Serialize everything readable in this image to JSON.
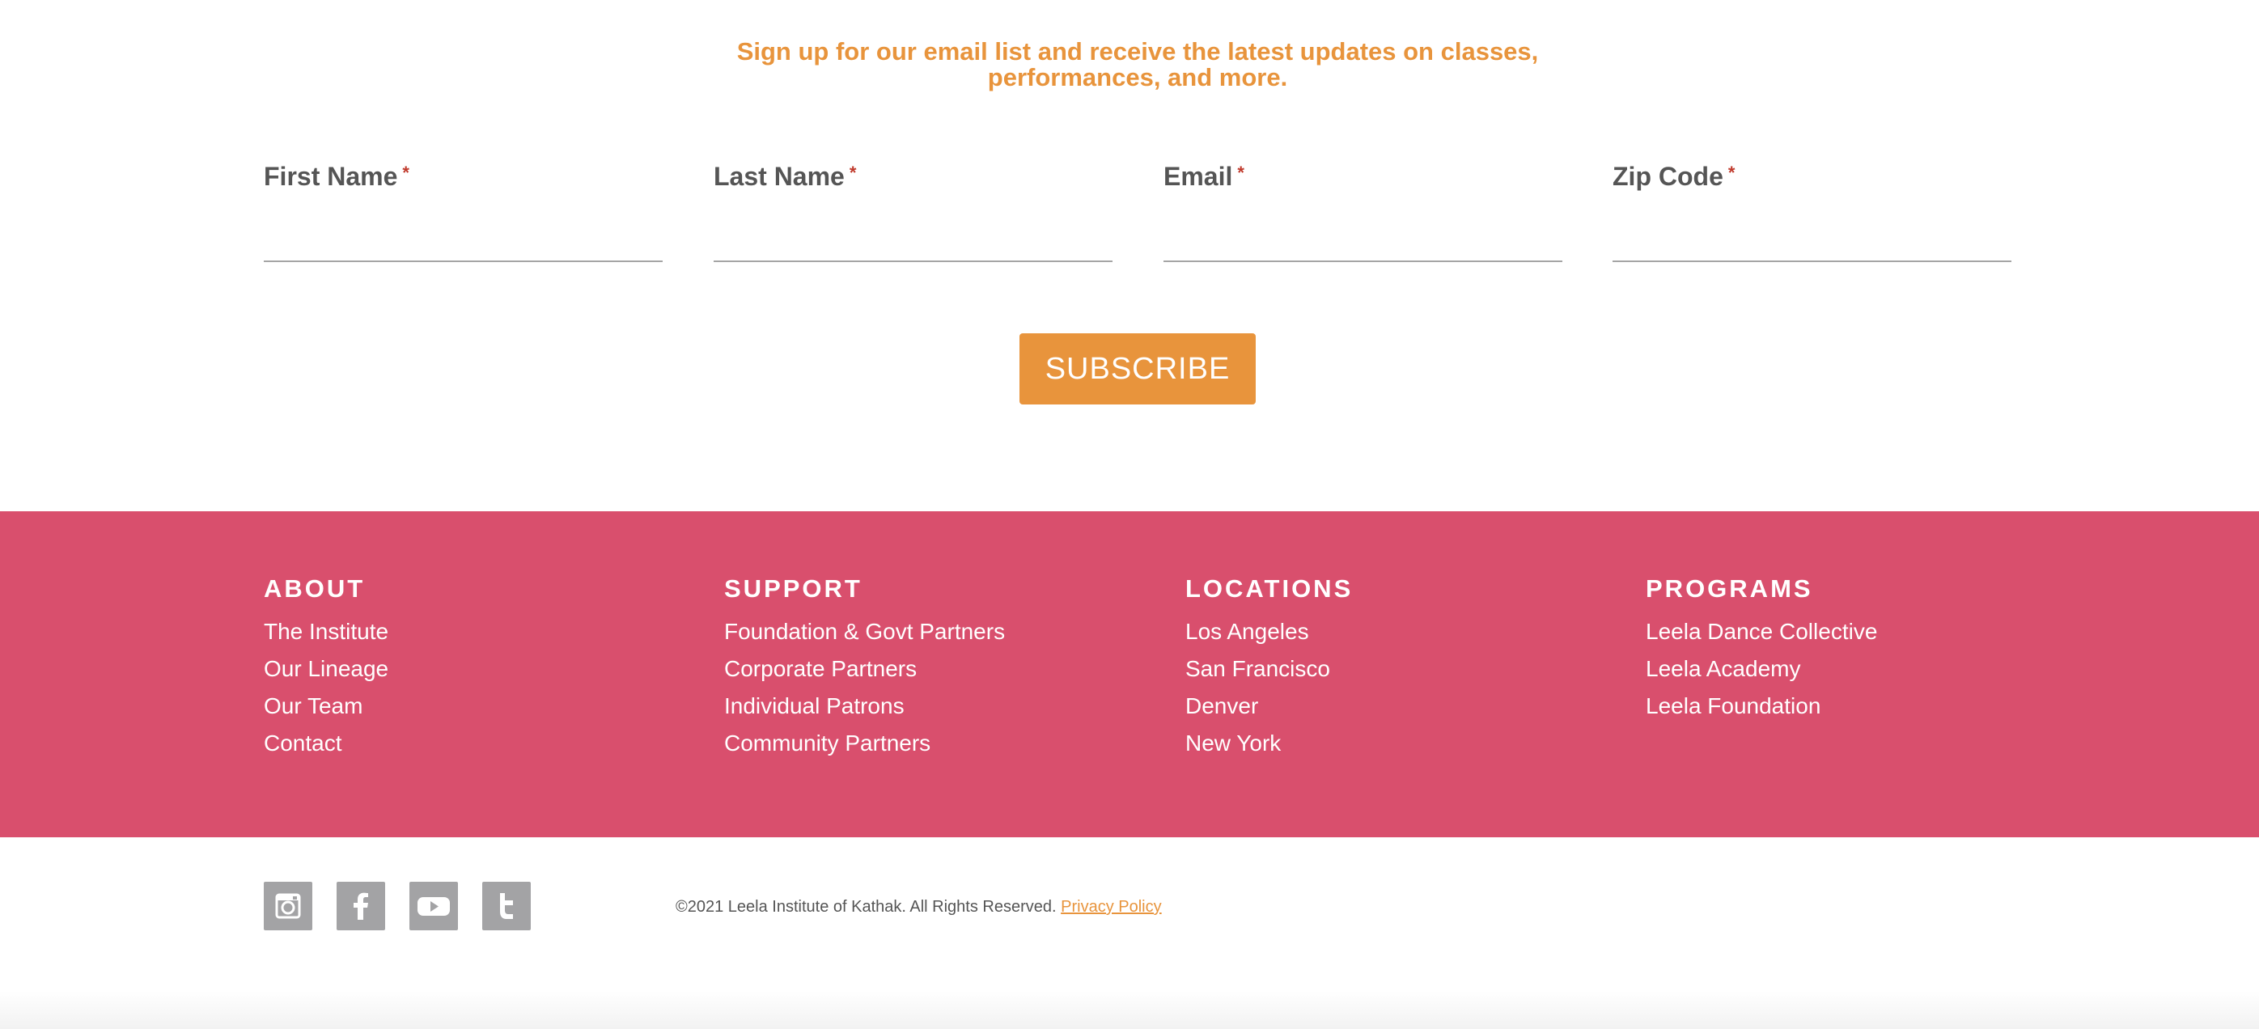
{
  "signup": {
    "heading": "Sign up for our email list and receive the latest updates on classes, performances, and more.",
    "required_marker": "*",
    "fields": [
      {
        "label": "First Name",
        "value": ""
      },
      {
        "label": "Last Name",
        "value": ""
      },
      {
        "label": "Email",
        "value": ""
      },
      {
        "label": "Zip Code",
        "value": ""
      }
    ],
    "submit_label": "SUBSCRIBE"
  },
  "footer": {
    "columns": [
      {
        "title": "ABOUT",
        "links": [
          "The Institute",
          "Our Lineage",
          "Our Team",
          "Contact"
        ]
      },
      {
        "title": "SUPPORT",
        "links": [
          "Foundation & Govt Partners",
          "Corporate Partners",
          "Individual Patrons",
          "Community Partners"
        ]
      },
      {
        "title": "LOCATIONS",
        "links": [
          "Los Angeles",
          "San Francisco",
          "Denver",
          "New York"
        ]
      },
      {
        "title": "PROGRAMS",
        "links": [
          "Leela Dance Collective",
          "Leela Academy",
          "Leela Foundation"
        ]
      }
    ]
  },
  "bottom": {
    "social_icons": [
      "instagram-icon",
      "facebook-icon",
      "youtube-icon",
      "twitter-icon"
    ],
    "copyright": "©2021 Leela Institute of Kathak. All Rights Reserved.",
    "privacy_link": "Privacy Policy"
  },
  "colors": {
    "accent_orange": "#e8943c",
    "footer_pink": "#d94f6d",
    "social_icon_gray": "#a3a3a5",
    "text_gray": "#555555",
    "required_red": "#c0392b"
  }
}
